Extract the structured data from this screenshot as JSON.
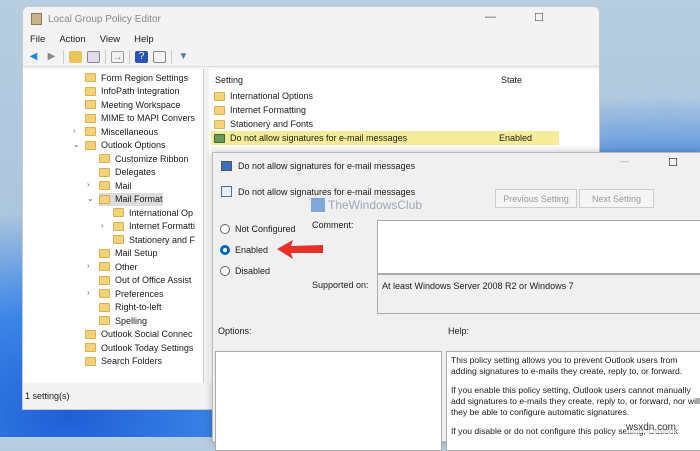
{
  "window": {
    "title": "Local Group Policy Editor",
    "menu": [
      "File",
      "Action",
      "View",
      "Help"
    ],
    "status": "1 setting(s)"
  },
  "tree": [
    {
      "label": "Form Region Settings",
      "level": 0
    },
    {
      "label": "InfoPath Integration",
      "level": 0
    },
    {
      "label": "Meeting Workspace",
      "level": 0
    },
    {
      "label": "MIME to MAPI Convers",
      "level": 0
    },
    {
      "label": "Miscellaneous",
      "level": 0,
      "chevron": ">"
    },
    {
      "label": "Outlook Options",
      "level": 0,
      "chevron": "v"
    },
    {
      "label": "Customize Ribbon",
      "level": 1
    },
    {
      "label": "Delegates",
      "level": 1
    },
    {
      "label": "Mail",
      "level": 1,
      "chevron": ">"
    },
    {
      "label": "Mail Format",
      "level": 1,
      "chevron": "v",
      "selected": true
    },
    {
      "label": "International Op",
      "level": 2
    },
    {
      "label": "Internet Formatti",
      "level": 2,
      "chevron": ">"
    },
    {
      "label": "Stationery and F",
      "level": 2
    },
    {
      "label": "Mail Setup",
      "level": 1
    },
    {
      "label": "Other",
      "level": 1,
      "chevron": ">"
    },
    {
      "label": "Out of Office Assist",
      "level": 1
    },
    {
      "label": "Preferences",
      "level": 1,
      "chevron": ">"
    },
    {
      "label": "Right-to-left",
      "level": 1
    },
    {
      "label": "Spelling",
      "level": 1
    },
    {
      "label": "Outlook Social Connec",
      "level": 0
    },
    {
      "label": "Outlook Today Settings",
      "level": 0
    },
    {
      "label": "Search Folders",
      "level": 0
    }
  ],
  "list": {
    "col_setting": "Setting",
    "col_state": "State",
    "rows": [
      {
        "name": "International Options",
        "state": "",
        "type": "folder"
      },
      {
        "name": "Internet Formatting",
        "state": "",
        "type": "folder"
      },
      {
        "name": "Stationery and Fonts",
        "state": "",
        "type": "folder"
      },
      {
        "name": "Do not allow signatures for e-mail messages",
        "state": "Enabled",
        "type": "policy",
        "highlight": "#f4ec98"
      }
    ]
  },
  "dialog": {
    "title": "Do not allow signatures for e-mail messages",
    "header": "Do not allow signatures for e-mail messages",
    "prev": "Previous Setting",
    "next": "Next Setting",
    "options": [
      "Not Configured",
      "Enabled",
      "Disabled"
    ],
    "selected": "Enabled",
    "comment_label": "Comment:",
    "supported_label": "Supported on:",
    "supported_value": "At least Windows Server 2008 R2 or Windows 7",
    "options_label": "Options:",
    "help_label": "Help:",
    "help": [
      "This policy setting allows you to prevent Outlook users from adding signatures to e-mails they create, reply to, or forward.",
      "If you enable this policy setting, Outlook users cannot manually add signatures to e-mails they create, reply to, or forward, nor will they be able to configure automatic signatures.",
      "If you disable or do not configure this policy setting, Outlook"
    ]
  },
  "watermark": "TheWindowsClub",
  "site": "wsxdn.com",
  "arrow_color": "#e8302a"
}
